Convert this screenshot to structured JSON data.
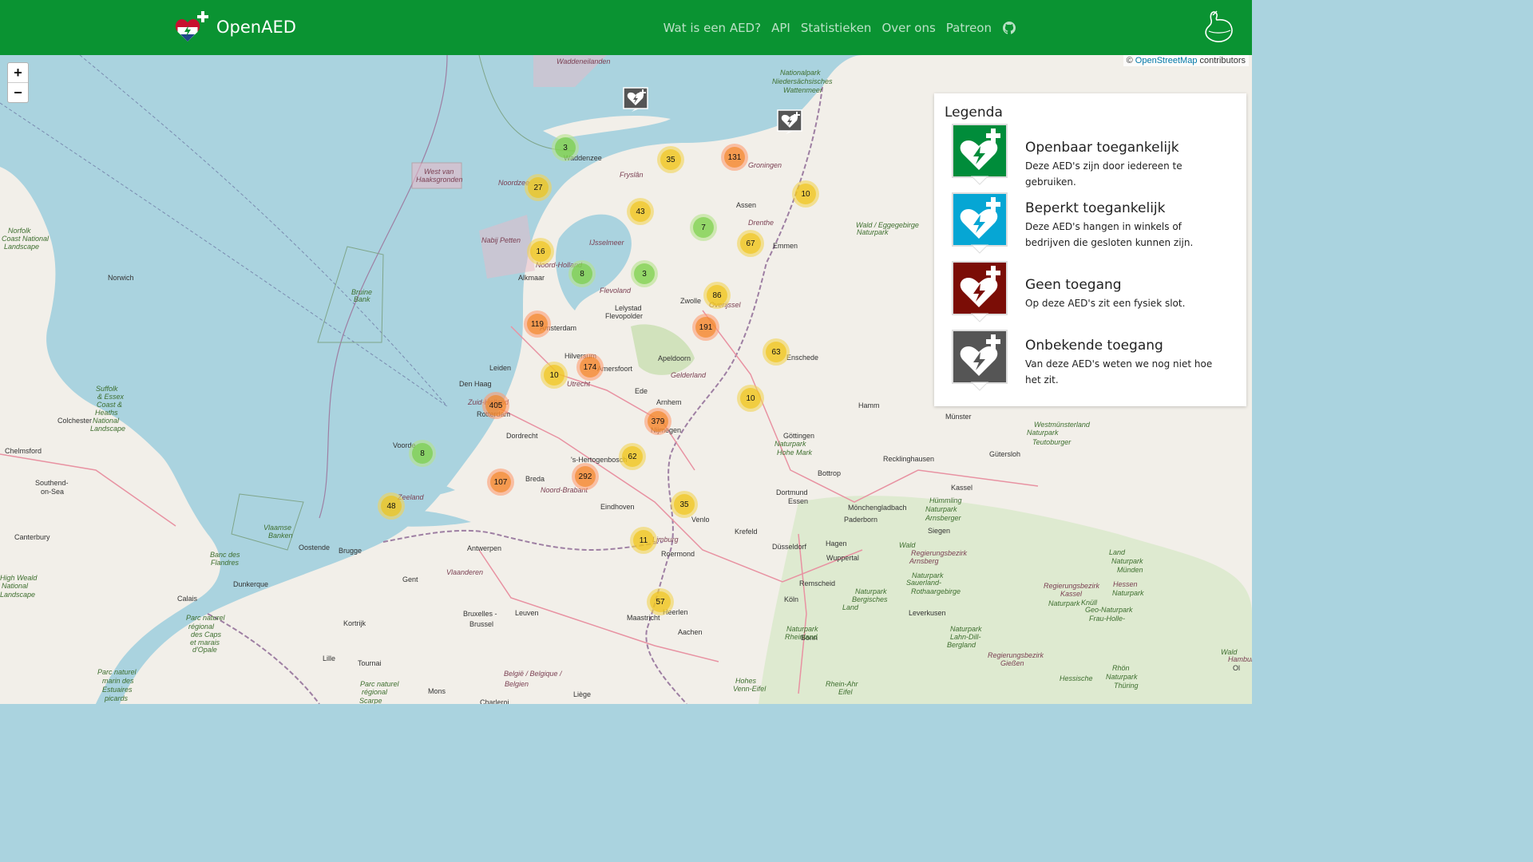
{
  "navbar": {
    "brand": "OpenAED",
    "links": [
      "Wat is een AED?",
      "API",
      "Statistieken",
      "Over ons",
      "Patreon"
    ],
    "github_icon": "github-icon",
    "ribbon_icon": "ukraine-ribbon-icon"
  },
  "map": {
    "attribution_prefix": "©",
    "attribution_link": "OpenStreetMap",
    "attribution_suffix": "contributors",
    "zoom_in": "+",
    "zoom_out": "−"
  },
  "clusters": [
    {
      "count": "3",
      "size": "small"
    },
    {
      "count": "35",
      "size": "medium"
    },
    {
      "count": "131",
      "size": "large"
    },
    {
      "count": "27",
      "size": "medium"
    },
    {
      "count": "10",
      "size": "medium"
    },
    {
      "count": "43",
      "size": "medium"
    },
    {
      "count": "7",
      "size": "small"
    },
    {
      "count": "67",
      "size": "medium"
    },
    {
      "count": "16",
      "size": "medium"
    },
    {
      "count": "8",
      "size": "small"
    },
    {
      "count": "3",
      "size": "small"
    },
    {
      "count": "86",
      "size": "medium"
    },
    {
      "count": "119",
      "size": "large"
    },
    {
      "count": "191",
      "size": "large"
    },
    {
      "count": "63",
      "size": "medium"
    },
    {
      "count": "174",
      "size": "large"
    },
    {
      "count": "10",
      "size": "medium"
    },
    {
      "count": "405",
      "size": "large"
    },
    {
      "count": "10",
      "size": "medium"
    },
    {
      "count": "379",
      "size": "large"
    },
    {
      "count": "8",
      "size": "small"
    },
    {
      "count": "62",
      "size": "medium"
    },
    {
      "count": "292",
      "size": "large"
    },
    {
      "count": "107",
      "size": "large"
    },
    {
      "count": "48",
      "size": "medium"
    },
    {
      "count": "35",
      "size": "medium"
    },
    {
      "count": "11",
      "size": "medium"
    },
    {
      "count": "57",
      "size": "medium"
    }
  ],
  "places": [
    {
      "name": "Waddeneilanden",
      "kind": "water"
    },
    {
      "name": "Nationalpark",
      "kind": "park"
    },
    {
      "name": "Niedersächsisches",
      "kind": "park"
    },
    {
      "name": "Wattenmeer",
      "kind": "park"
    },
    {
      "name": "Waddenzee",
      "kind": "city"
    },
    {
      "name": "West van",
      "kind": "water"
    },
    {
      "name": "Haaksgronden",
      "kind": "water"
    },
    {
      "name": "Noordzee",
      "kind": "water"
    },
    {
      "name": "Groningen",
      "kind": "water"
    },
    {
      "name": "Fryslân",
      "kind": "water"
    },
    {
      "name": "Assen",
      "kind": "city"
    },
    {
      "name": "Drenthe",
      "kind": "water"
    },
    {
      "name": "Nabij Petten",
      "kind": "water"
    },
    {
      "name": "IJsselmeer",
      "kind": "water"
    },
    {
      "name": "Emmen",
      "kind": "city"
    },
    {
      "name": "Noord-Holland",
      "kind": "water"
    },
    {
      "name": "Alkmaar",
      "kind": "city"
    },
    {
      "name": "Norfolk",
      "kind": "park"
    },
    {
      "name": "Coast National",
      "kind": "park"
    },
    {
      "name": "Landscape",
      "kind": "park"
    },
    {
      "name": "Norwich",
      "kind": "city"
    },
    {
      "name": "Bruine",
      "kind": "park"
    },
    {
      "name": "Bank",
      "kind": "park"
    },
    {
      "name": "Flevoland",
      "kind": "water"
    },
    {
      "name": "Zwolle",
      "kind": "city"
    },
    {
      "name": "Overijssel",
      "kind": "water"
    },
    {
      "name": "Lelystad",
      "kind": "city"
    },
    {
      "name": "Flevopolder",
      "kind": "city"
    },
    {
      "name": "Amsterdam",
      "kind": "city"
    },
    {
      "name": "Hilversum",
      "kind": "city"
    },
    {
      "name": "Leiden",
      "kind": "city"
    },
    {
      "name": "Amersfoort",
      "kind": "city"
    },
    {
      "name": "Apeldoorn",
      "kind": "city"
    },
    {
      "name": "Enschede",
      "kind": "city"
    },
    {
      "name": "Gelderland",
      "kind": "water"
    },
    {
      "name": "Utrecht",
      "kind": "water"
    },
    {
      "name": "Den Haag",
      "kind": "city"
    },
    {
      "name": "Zuid-Holland",
      "kind": "water"
    },
    {
      "name": "Rotterdam",
      "kind": "city"
    },
    {
      "name": "Ede",
      "kind": "city"
    },
    {
      "name": "Arnhem",
      "kind": "city"
    },
    {
      "name": "Nijmegen",
      "kind": "city"
    },
    {
      "name": "Dordrecht",
      "kind": "city"
    },
    {
      "name": "Suffolk",
      "kind": "park"
    },
    {
      "name": "& Essex",
      "kind": "park"
    },
    {
      "name": "Coast &",
      "kind": "park"
    },
    {
      "name": "Heaths",
      "kind": "park"
    },
    {
      "name": "National",
      "kind": "park"
    },
    {
      "name": "Landscape",
      "kind": "park"
    },
    {
      "name": "Colchester",
      "kind": "city"
    },
    {
      "name": "Chelmsford",
      "kind": "city"
    },
    {
      "name": "Voorde",
      "kind": "city"
    },
    {
      "name": "'s-Hertogenbosch",
      "kind": "city"
    },
    {
      "name": "Breda",
      "kind": "city"
    },
    {
      "name": "Noord-Brabant",
      "kind": "water"
    },
    {
      "name": "Zeeland",
      "kind": "water"
    },
    {
      "name": "Eindhoven",
      "kind": "city"
    },
    {
      "name": "Southend-",
      "kind": "city"
    },
    {
      "name": "on-Sea",
      "kind": "city"
    },
    {
      "name": "Vlaamse",
      "kind": "park"
    },
    {
      "name": "Banken",
      "kind": "park"
    },
    {
      "name": "Venlo",
      "kind": "city"
    },
    {
      "name": "Canterbury",
      "kind": "city"
    },
    {
      "name": "Oostende",
      "kind": "city"
    },
    {
      "name": "Brugge",
      "kind": "city"
    },
    {
      "name": "Antwerpen",
      "kind": "city"
    },
    {
      "name": "Limburg",
      "kind": "water"
    },
    {
      "name": "Roermond",
      "kind": "city"
    },
    {
      "name": "Banc des",
      "kind": "park"
    },
    {
      "name": "Flandres",
      "kind": "park"
    },
    {
      "name": "Vlaanderen",
      "kind": "water"
    },
    {
      "name": "Gent",
      "kind": "city"
    },
    {
      "name": "Dunkerque",
      "kind": "city"
    },
    {
      "name": "Calais",
      "kind": "city"
    },
    {
      "name": "Kortrijk",
      "kind": "city"
    },
    {
      "name": "Bruxelles -",
      "kind": "city"
    },
    {
      "name": "Brussel",
      "kind": "city"
    },
    {
      "name": "Leuven",
      "kind": "city"
    },
    {
      "name": "Maastricht",
      "kind": "city"
    },
    {
      "name": "Heerlen",
      "kind": "city"
    },
    {
      "name": "Aachen",
      "kind": "city"
    },
    {
      "name": "Lille",
      "kind": "city"
    },
    {
      "name": "Tournai",
      "kind": "city"
    },
    {
      "name": "België / Belgique /",
      "kind": "water"
    },
    {
      "name": "Belgien",
      "kind": "water"
    },
    {
      "name": "Liège",
      "kind": "city"
    },
    {
      "name": "Mons",
      "kind": "city"
    },
    {
      "name": "Charleroi",
      "kind": "city"
    },
    {
      "name": "Parc naturel",
      "kind": "park"
    },
    {
      "name": "marin des",
      "kind": "park"
    },
    {
      "name": "Estuaires",
      "kind": "park"
    },
    {
      "name": "picards",
      "kind": "park"
    },
    {
      "name": "Parc naturel",
      "kind": "park"
    },
    {
      "name": "régional",
      "kind": "park"
    },
    {
      "name": "des Caps",
      "kind": "park"
    },
    {
      "name": "et marais",
      "kind": "park"
    },
    {
      "name": "d'Opale",
      "kind": "park"
    },
    {
      "name": "Parc naturel",
      "kind": "park"
    },
    {
      "name": "régional",
      "kind": "park"
    },
    {
      "name": "Scarpe",
      "kind": "park"
    },
    {
      "name": "High Weald",
      "kind": "park"
    },
    {
      "name": "National",
      "kind": "park"
    },
    {
      "name": "Landscape",
      "kind": "park"
    },
    {
      "name": "Köln",
      "kind": "city"
    },
    {
      "name": "Bonn",
      "kind": "city"
    },
    {
      "name": "Düsseldorf",
      "kind": "city"
    },
    {
      "name": "Mönchengladbach",
      "kind": "city"
    },
    {
      "name": "Krefeld",
      "kind": "city"
    },
    {
      "name": "Essen",
      "kind": "city"
    },
    {
      "name": "Dortmund",
      "kind": "city"
    },
    {
      "name": "Bottrop",
      "kind": "city"
    },
    {
      "name": "Recklinghausen",
      "kind": "city"
    },
    {
      "name": "Hamm",
      "kind": "city"
    },
    {
      "name": "Münster",
      "kind": "city"
    },
    {
      "name": "Gütersloh",
      "kind": "city"
    },
    {
      "name": "Paderborn",
      "kind": "city"
    },
    {
      "name": "Hagen",
      "kind": "city"
    },
    {
      "name": "Wuppertal",
      "kind": "city"
    },
    {
      "name": "Remscheid",
      "kind": "city"
    },
    {
      "name": "Leverkusen",
      "kind": "city"
    },
    {
      "name": "Siegen",
      "kind": "city"
    },
    {
      "name": "Kassel",
      "kind": "city"
    },
    {
      "name": "Göttingen",
      "kind": "city"
    },
    {
      "name": "Naturpark",
      "kind": "park"
    },
    {
      "name": "Hohe Mark",
      "kind": "park"
    },
    {
      "name": "Westmünsterland",
      "kind": "park"
    },
    {
      "name": "Naturpark",
      "kind": "park"
    },
    {
      "name": "Teutoburger",
      "kind": "park"
    },
    {
      "name": "Wald / Eggegebirge",
      "kind": "park"
    },
    {
      "name": "Naturpark",
      "kind": "park"
    },
    {
      "name": "Hümmling",
      "kind": "park"
    },
    {
      "name": "Naturpark",
      "kind": "park"
    },
    {
      "name": "Arnsberger",
      "kind": "park"
    },
    {
      "name": "Wald",
      "kind": "park"
    },
    {
      "name": "Regierungsbezirk",
      "kind": "water"
    },
    {
      "name": "Arnsberg",
      "kind": "water"
    },
    {
      "name": "Naturpark",
      "kind": "park"
    },
    {
      "name": "Sauerland-",
      "kind": "park"
    },
    {
      "name": "Rothaargebirge",
      "kind": "park"
    },
    {
      "name": "Naturpark",
      "kind": "park"
    },
    {
      "name": "Bergisches",
      "kind": "park"
    },
    {
      "name": "Land",
      "kind": "park"
    },
    {
      "name": "Naturpark",
      "kind": "park"
    },
    {
      "name": "Rheinland",
      "kind": "park"
    },
    {
      "name": "Hohes",
      "kind": "park"
    },
    {
      "name": "Venn-Eifel",
      "kind": "park"
    },
    {
      "name": "Rhein-Ahr",
      "kind": "park"
    },
    {
      "name": "Eifel",
      "kind": "park"
    },
    {
      "name": "Naturpark",
      "kind": "park"
    },
    {
      "name": "Lahn-Dill-",
      "kind": "park"
    },
    {
      "name": "Bergland",
      "kind": "park"
    },
    {
      "name": "Regierungsbezirk",
      "kind": "water"
    },
    {
      "name": "Gießen",
      "kind": "water"
    },
    {
      "name": "Regierungsbezirk",
      "kind": "water"
    },
    {
      "name": "Kassel",
      "kind": "water"
    },
    {
      "name": "Naturpark",
      "kind": "park"
    },
    {
      "name": "Knüll",
      "kind": "park"
    },
    {
      "name": "Geo-Naturpark",
      "kind": "park"
    },
    {
      "name": "Frau-Holle-",
      "kind": "park"
    },
    {
      "name": "Land",
      "kind": "park"
    },
    {
      "name": "Naturpark",
      "kind": "park"
    },
    {
      "name": "Münden",
      "kind": "park"
    },
    {
      "name": "Hessen",
      "kind": "water"
    },
    {
      "name": "Naturpark",
      "kind": "park"
    },
    {
      "name": "Hessische",
      "kind": "park"
    },
    {
      "name": "Rhön",
      "kind": "park"
    },
    {
      "name": "Naturpark",
      "kind": "park"
    },
    {
      "name": "Thüring",
      "kind": "park"
    },
    {
      "name": "Wald",
      "kind": "park"
    },
    {
      "name": "Hamburg",
      "kind": "water"
    },
    {
      "name": "Ol",
      "kind": "city"
    }
  ],
  "legend": {
    "title": "Legenda",
    "items": [
      {
        "title": "Openbaar toegankelijk",
        "description": "Deze AED's zijn door iedereen te gebruiken.",
        "color": "#008c3a",
        "icon": "aed-public-icon"
      },
      {
        "title": "Beperkt toegankelijk",
        "description": "Deze AED's hangen in winkels of bedrijven die gesloten kunnen zijn.",
        "color": "#06a6d4",
        "icon": "aed-limited-icon"
      },
      {
        "title": "Geen toegang",
        "description": "Op deze AED's zit een fysiek slot.",
        "color": "#7b0d06",
        "icon": "aed-no-access-icon"
      },
      {
        "title": "Onbekende toegang",
        "description": "Van deze AED's weten we nog niet hoe het zit.",
        "color": "#555555",
        "icon": "aed-unknown-icon"
      }
    ]
  },
  "colors": {
    "navbar": "#0a9332",
    "sea": "#aad3df",
    "land": "#f2efe9"
  }
}
